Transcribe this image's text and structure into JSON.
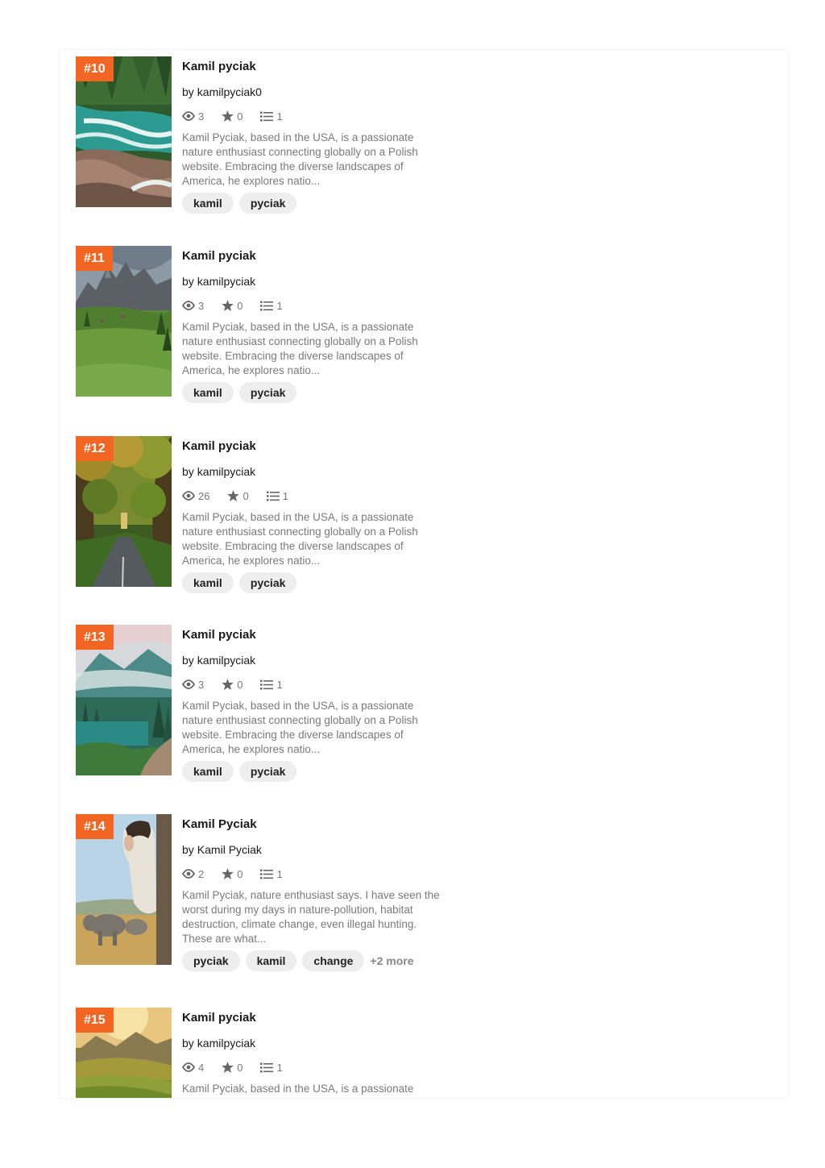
{
  "items": [
    {
      "rank": "#10",
      "title": "Kamil pyciak",
      "by": "by",
      "author": "kamilpyciak0",
      "views": "3",
      "stars": "0",
      "lists": "1",
      "description": "Kamil Pyciak, based in the USA, is a passionate nature enthusiast connecting globally on a Polish website. Embracing the diverse landscapes of America, he explores natio...",
      "tags": [
        "kamil",
        "pyciak"
      ],
      "more": "",
      "thumbnail_icon": "river-rapids-photo"
    },
    {
      "rank": "#11",
      "title": "Kamil pyciak",
      "by": "by",
      "author": "kamilpyciak",
      "views": "3",
      "stars": "0",
      "lists": "1",
      "description": "Kamil Pyciak, based in the USA, is a passionate nature enthusiast connecting globally on a Polish website. Embracing the diverse landscapes of America, he explores natio...",
      "tags": [
        "kamil",
        "pyciak"
      ],
      "more": "",
      "thumbnail_icon": "mountain-meadow-photo"
    },
    {
      "rank": "#12",
      "title": "Kamil pyciak",
      "by": "by",
      "author": "kamilpyciak",
      "views": "26",
      "stars": "0",
      "lists": "1",
      "description": "Kamil Pyciak, based in the USA, is a passionate nature enthusiast connecting globally on a Polish website. Embracing the diverse landscapes of America, he explores natio...",
      "tags": [
        "kamil",
        "pyciak"
      ],
      "more": "",
      "thumbnail_icon": "forest-road-photo"
    },
    {
      "rank": "#13",
      "title": "Kamil pyciak",
      "by": "by",
      "author": "kamilpyciak",
      "views": "3",
      "stars": "0",
      "lists": "1",
      "description": "Kamil Pyciak, based in the USA, is a passionate nature enthusiast connecting globally on a Polish website. Embracing the diverse landscapes of America, he explores natio...",
      "tags": [
        "kamil",
        "pyciak"
      ],
      "more": "",
      "thumbnail_icon": "misty-lake-forest-photo"
    },
    {
      "rank": "#14",
      "title": "Kamil Pyciak",
      "by": "by",
      "author": "Kamil Pyciak",
      "views": "2",
      "stars": "0",
      "lists": "1",
      "description": "Kamil Pyciak, nature enthusiast says. I have seen the worst during my days in nature-pollution, habitat destruction, climate change, even illegal hunting. These are what...",
      "tags": [
        "pyciak",
        "kamil",
        "change"
      ],
      "more": "+2 more",
      "thumbnail_icon": "safari-elephant-photo"
    },
    {
      "rank": "#15",
      "title": "Kamil pyciak",
      "by": "by",
      "author": "kamilpyciak",
      "views": "4",
      "stars": "0",
      "lists": "1",
      "description": "Kamil Pyciak, based in the USA, is a passionate",
      "tags": [],
      "more": "",
      "thumbnail_icon": "sunset-hills-photo"
    }
  ],
  "colors": {
    "rank_badge": "#f26522",
    "tag_bg": "#eeeeee",
    "muted_text": "#7a7a7a"
  }
}
